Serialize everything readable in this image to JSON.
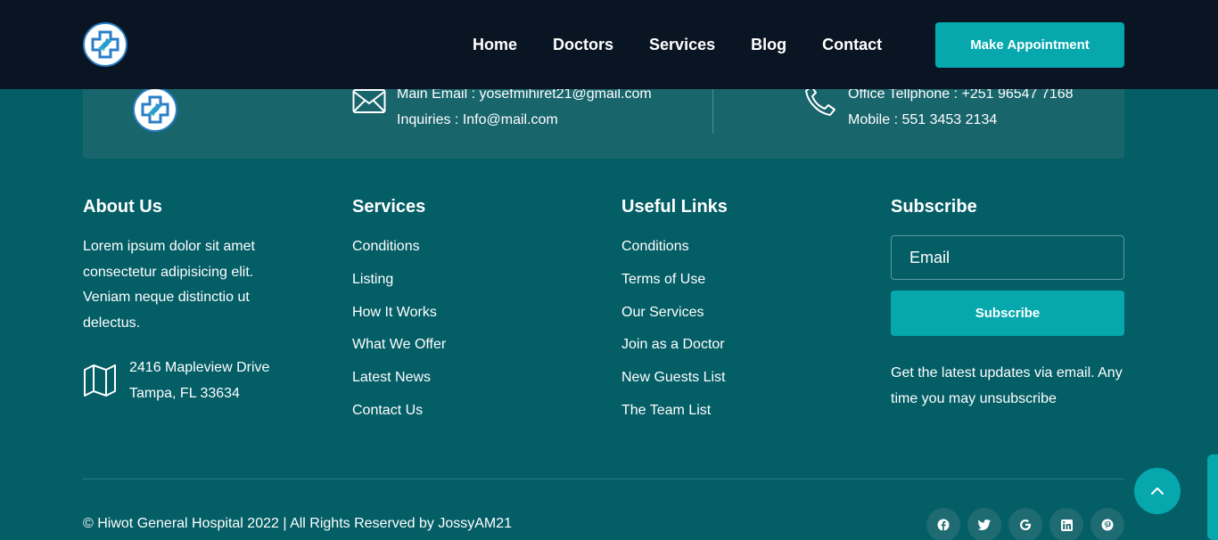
{
  "header": {
    "nav": [
      "Home",
      "Doctors",
      "Services",
      "Blog",
      "Contact"
    ],
    "cta_label": "Make Appointment"
  },
  "contact": {
    "main_email": "Main Email : yosefmihiret21@gmail.com",
    "inquiries": "Inquiries : Info@mail.com",
    "office_phone": "Office Tellphone : +251 96547 7168",
    "mobile": "Mobile : 551 3453 2134"
  },
  "about": {
    "title": "About Us",
    "text": "Lorem ipsum dolor sit amet consectetur adipisicing elit. Veniam neque distinctio ut delectus.",
    "address_line1": "2416 Mapleview Drive",
    "address_line2": "Tampa, FL 33634"
  },
  "services": {
    "title": "Services",
    "links": [
      "Conditions",
      "Listing",
      "How It Works",
      "What We Offer",
      "Latest News",
      "Contact Us"
    ]
  },
  "useful_links": {
    "title": "Useful Links",
    "links": [
      "Conditions",
      "Terms of Use",
      "Our Services",
      "Join as a Doctor",
      "New Guests List",
      "The Team List"
    ]
  },
  "subscribe": {
    "title": "Subscribe",
    "email_placeholder": "Email",
    "button_label": "Subscribe",
    "note": "Get the latest updates via email. Any time you may unsubscribe"
  },
  "footer": {
    "copyright": "© Hiwot General Hospital 2022 | All Rights Reserved by JossyAM21",
    "social_icons": [
      "facebook-icon",
      "twitter-icon",
      "google-icon",
      "linkedin-icon",
      "pinterest-icon"
    ]
  },
  "colors": {
    "page_bg": "#045e66",
    "header_bg": "#0a1523",
    "accent": "#06a8ae",
    "band_bg": "#19656c"
  }
}
